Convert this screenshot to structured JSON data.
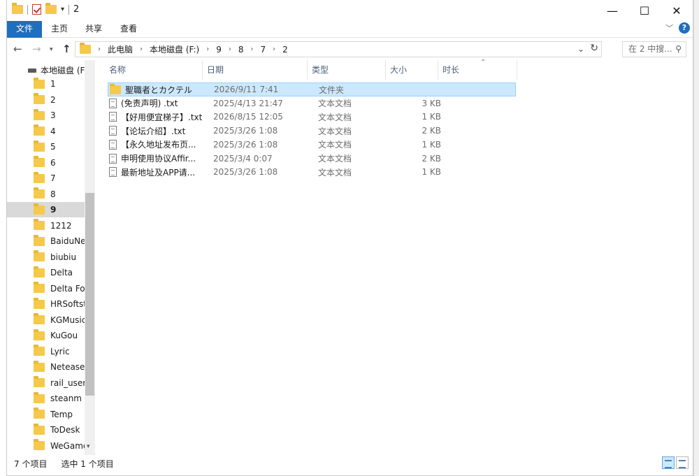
{
  "window": {
    "title": "2",
    "controls": {
      "minimize": "—",
      "maximize": "☐",
      "close": "✕"
    }
  },
  "ribbon": {
    "tabs": [
      "文件",
      "主页",
      "共享",
      "查看"
    ],
    "help": "?"
  },
  "nav": {
    "breadcrumbs": [
      "此电脑",
      "本地磁盘 (F:)",
      "9",
      "8",
      "7",
      "2"
    ],
    "search_placeholder": "在 2 中搜..."
  },
  "sidebar": {
    "drive": "本地磁盘 (F:",
    "items": [
      "1",
      "2",
      "3",
      "4",
      "5",
      "6",
      "7",
      "8",
      "9",
      "1212",
      "BaiduNetd",
      "biubiu",
      "Delta",
      "Delta Forc",
      "HRSoftsto",
      "KGMusic",
      "KuGou",
      "Lyric",
      "Netease",
      "rail_user_d",
      "steanm",
      "Temp",
      "ToDesk",
      "WeGameA"
    ],
    "selected": "9"
  },
  "columns": {
    "name": "名称",
    "date": "日期",
    "type": "类型",
    "size": "大小",
    "duration": "时长"
  },
  "files": [
    {
      "icon": "folder-icon",
      "name": "聖職者とカクテル",
      "date": "2026/9/11 7:41",
      "type": "文件夹",
      "size": "",
      "selected": true
    },
    {
      "icon": "text-file-icon",
      "name": "(免责声明) .txt",
      "date": "2025/4/13 21:47",
      "type": "文本文档",
      "size": "3 KB",
      "selected": false
    },
    {
      "icon": "text-file-icon",
      "name": "【好用便宜梯子】.txt",
      "date": "2026/8/15 12:05",
      "type": "文本文档",
      "size": "1 KB",
      "selected": false
    },
    {
      "icon": "text-file-icon",
      "name": "【论坛介绍】.txt",
      "date": "2025/3/26 1:08",
      "type": "文本文档",
      "size": "2 KB",
      "selected": false
    },
    {
      "icon": "text-file-icon",
      "name": "【永久地址发布页...",
      "date": "2025/3/26 1:08",
      "type": "文本文档",
      "size": "1 KB",
      "selected": false
    },
    {
      "icon": "text-file-icon",
      "name": "申明使用协议Affir...",
      "date": "2025/3/4 0:07",
      "type": "文本文档",
      "size": "2 KB",
      "selected": false
    },
    {
      "icon": "text-file-icon",
      "name": "最新地址及APP请...",
      "date": "2025/3/26 1:08",
      "type": "文本文档",
      "size": "1 KB",
      "selected": false
    }
  ],
  "status": {
    "count": "7 个项目",
    "selection": "选中 1 个项目"
  },
  "colors": {
    "accent": "#1e6fbd",
    "selection": "#cce8ff",
    "folder": "#f5c94a"
  }
}
